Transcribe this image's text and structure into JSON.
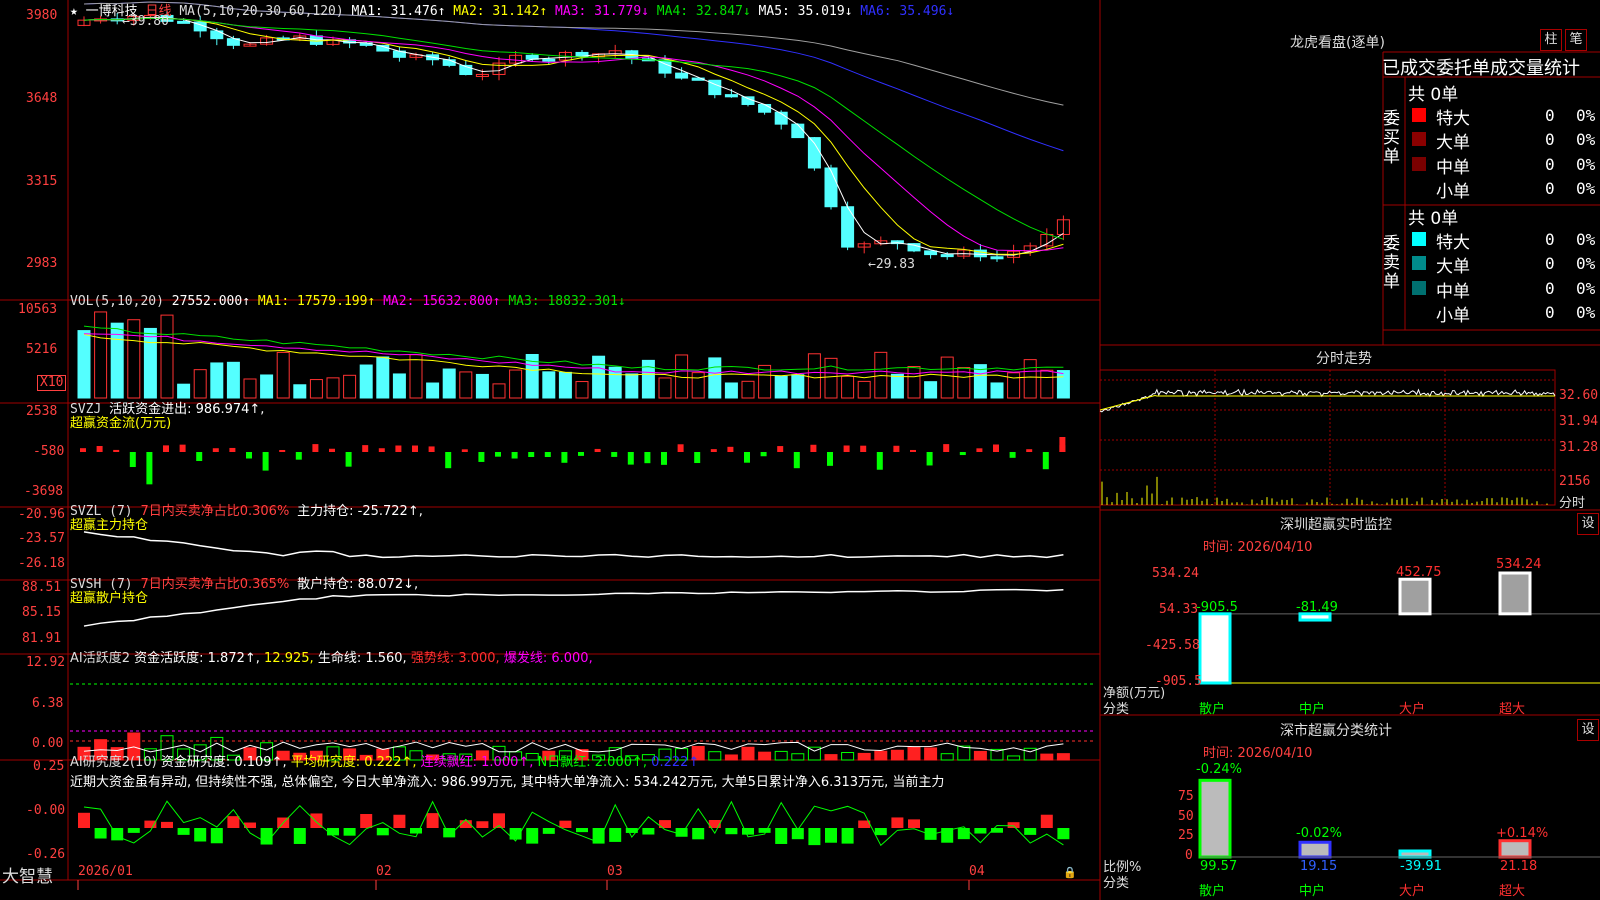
{
  "colors": {
    "up": "#ff3232",
    "down": "#54ffff",
    "frame": "#a00000",
    "ma1": "#ffffff",
    "ma2": "#ffff00",
    "ma3": "#ff00ff",
    "ma4": "#00e000",
    "ma5": "#3030ff",
    "ma6": "#a0a0a0",
    "green": "#00ff00",
    "red": "#ff2020",
    "axis": "#ff4040"
  },
  "header": {
    "star": "★",
    "stock_name": "一博科技",
    "period": "日线",
    "ma_label": "MA(5,10,20,30,60,120)",
    "ma1": "MA1: 31.476↑",
    "ma2": "MA2: 31.142↑",
    "ma3": "MA3: 31.779↓",
    "ma4": "MA4: 32.847↓",
    "ma5": "MA5: 35.019↓",
    "ma6": "MA6: 35.496↓",
    "high_mark": "←39.80",
    "low_mark": "←29.83"
  },
  "price_axis": [
    "3980",
    "3648",
    "3315",
    "2983"
  ],
  "vol": {
    "title": "VOL(5,10,20)",
    "value": "27552.000↑",
    "ma1": "MA1: 17579.199↑",
    "ma2": "MA2: 15632.800↑",
    "ma3": "MA3: 18832.301↓",
    "axis": [
      "10563",
      "5216"
    ],
    "unit": "X10"
  },
  "svzj": {
    "title": "SVZJ",
    "desc": "活跃资金进出: 986.974↑,",
    "sub": "超赢资金流(万元)",
    "axis": [
      "2538",
      "-580",
      "-3698"
    ]
  },
  "svzl": {
    "title": "SVZL (7)",
    "desc1": "7日内买卖净占比0.306%",
    "desc2": "主力持仓: -25.722↑,",
    "sub": "超赢主力持仓",
    "axis": [
      "-20.96",
      "-23.57",
      "-26.18"
    ]
  },
  "svsh": {
    "title": "SVSH (7)",
    "desc1": "7日内买卖净占比0.365%",
    "desc2": "散户持仓: 88.072↓,",
    "sub": "超赢散户持仓",
    "axis": [
      "88.51",
      "85.15",
      "81.91"
    ]
  },
  "ai1": {
    "title": "AI活跃度2",
    "a": "资金活跃度: 1.872↑,",
    "b": "12.925,",
    "c": "生命线: 1.560,",
    "d": "强势线: 3.000,",
    "e": "爆发线: 6.000,",
    "axis": [
      "12.92",
      "6.38",
      "0.00"
    ]
  },
  "ai2": {
    "title": "AI研究度2(10)",
    "a": "资金研究度: 0.109↑,",
    "b": "平均研究度: 0.222↑,",
    "c": "连续飘红: 1.000↑,",
    "d": "N日飘红: 2.000↑,",
    "e": "0.222↑",
    "text": "近期大资金虽有异动, 但持续性不强, 总体偏空, 今日大单净流入: 986.99万元, 其中特大单净流入: 534.242万元, 大单5日累计净入6.313万元, 当前主力",
    "axis": [
      "0.25",
      "-0.00",
      "-0.26"
    ]
  },
  "xaxis": {
    "labels": [
      "2026/01",
      "02",
      "03",
      "04"
    ],
    "logo": "大智慧"
  },
  "longhu": {
    "title": "龙虎看盘(逐单)",
    "btn1": "柱",
    "btn2": "笔",
    "headline": "已成交委托单成交量统计",
    "buy_side": "委买单",
    "sell_side": "委卖单",
    "buy_total": "共 0单",
    "sell_total": "共 0单",
    "rows": [
      {
        "name": "特大",
        "count": "0",
        "pct": "0%"
      },
      {
        "name": "大单",
        "count": "0",
        "pct": "0%"
      },
      {
        "name": "中单",
        "count": "0",
        "pct": "0%"
      },
      {
        "name": "小单",
        "count": "0",
        "pct": "0%"
      }
    ],
    "buy_colors": [
      "#ff0000",
      "#8b0000",
      "#7a0000",
      ""
    ],
    "sell_colors": [
      "#00ffff",
      "#008b8b",
      "#007070",
      ""
    ]
  },
  "fenshi": {
    "title": "分时走势",
    "axis": [
      "32.60",
      "31.94",
      "31.28"
    ],
    "vol_label": "2156",
    "unit": "分时"
  },
  "monitor": {
    "title": "深圳超赢实时监控",
    "btn": "设",
    "time": "时间: 2026/04/10",
    "axis": [
      "534.24",
      "54.33",
      "-425.58",
      "-905.5"
    ],
    "ylabel": "净额(万元)",
    "xlabel": "分类",
    "cats": [
      "散户",
      "中户",
      "大户",
      "超大"
    ],
    "values": [
      "-905.5",
      "-81.49",
      "452.75",
      "534.24"
    ]
  },
  "classify": {
    "title": "深市超赢分类统计",
    "btn": "设",
    "time": "时间: 2026/04/10",
    "axis": [
      "75",
      "50",
      "25",
      "0"
    ],
    "ylabel": "比例%",
    "xlabel": "分类",
    "cats": [
      "散户",
      "中户",
      "大户",
      "超大"
    ],
    "top": [
      "-0.24%",
      "-0.02%",
      "",
      "+0.14%"
    ],
    "bottom": [
      "99.57",
      "19.15",
      "-39.91",
      "21.18"
    ]
  },
  "chart_data": [
    {
      "type": "bar",
      "title": "深圳超赢实时监控",
      "ylabel": "净额(万元)",
      "xlabel": "分类",
      "categories": [
        "散户",
        "中户",
        "大户",
        "超大"
      ],
      "values": [
        -905.5,
        -81.49,
        452.75,
        534.24
      ],
      "ylim": [
        -905.5,
        534.24
      ]
    },
    {
      "type": "bar",
      "title": "深市超赢分类统计",
      "ylabel": "比例%",
      "xlabel": "分类",
      "categories": [
        "散户",
        "中户",
        "大户",
        "超大"
      ],
      "values": [
        99.57,
        19.15,
        -39.91,
        21.18
      ],
      "ylim": [
        0,
        100
      ]
    }
  ]
}
